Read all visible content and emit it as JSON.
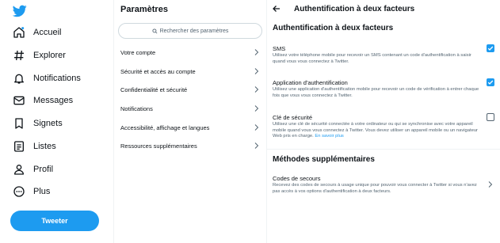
{
  "colors": {
    "accent": "#1d9bf0",
    "text": "#0f1419",
    "secondary": "#536471",
    "border": "#cfd9de"
  },
  "sidebar": {
    "logo_icon": "twitter-bird-icon",
    "items": [
      {
        "label": "Accueil",
        "icon": "home-icon"
      },
      {
        "label": "Explorer",
        "icon": "hashtag-icon"
      },
      {
        "label": "Notifications",
        "icon": "bell-icon"
      },
      {
        "label": "Messages",
        "icon": "envelope-icon"
      },
      {
        "label": "Signets",
        "icon": "bookmark-icon"
      },
      {
        "label": "Listes",
        "icon": "list-icon"
      },
      {
        "label": "Profil",
        "icon": "person-icon"
      },
      {
        "label": "Plus",
        "icon": "more-circle-icon"
      }
    ],
    "tweet_button": "Tweeter"
  },
  "settings": {
    "title": "Paramètres",
    "search_placeholder": "Rechercher des paramètres",
    "items": [
      "Votre compte",
      "Sécurité et accès au compte",
      "Confidentialité et sécurité",
      "Notifications",
      "Accessibilité, affichage et langues",
      "Ressources supplémentaires"
    ]
  },
  "detail": {
    "header": "Authentification à deux facteurs",
    "section_title": "Authentification à deux facteurs",
    "options": [
      {
        "label": "SMS",
        "description": "Utilisez votre téléphone mobile pour recevoir un SMS contenant un code d'authentification à saisir quand vous vous connectez à Twitter.",
        "checked": true
      },
      {
        "label": "Application d'authentification",
        "description": "Utilisez une application d'authentification mobile pour recevoir un code de vérification à entrer chaque fois que vous vous connectez à Twitter.",
        "checked": true
      },
      {
        "label": "Clé de sécurité",
        "description": "Utilisez une clé de sécurité connectée à votre ordinateur ou qui se synchronise avec votre appareil mobile quand vous vous connectez à Twitter. Vous devez utiliser un appareil mobile ou un navigateur Web pris en charge.",
        "link": "En savoir plus",
        "checked": false
      }
    ],
    "extra_title": "Méthodes supplémentaires",
    "backup": {
      "label": "Codes de secours",
      "description": "Recevez des codes de secours à usage unique pour pouvoir vous connecter à Twitter si vous n'avez pas accès à vos options d'authentification à deux facteurs."
    }
  }
}
